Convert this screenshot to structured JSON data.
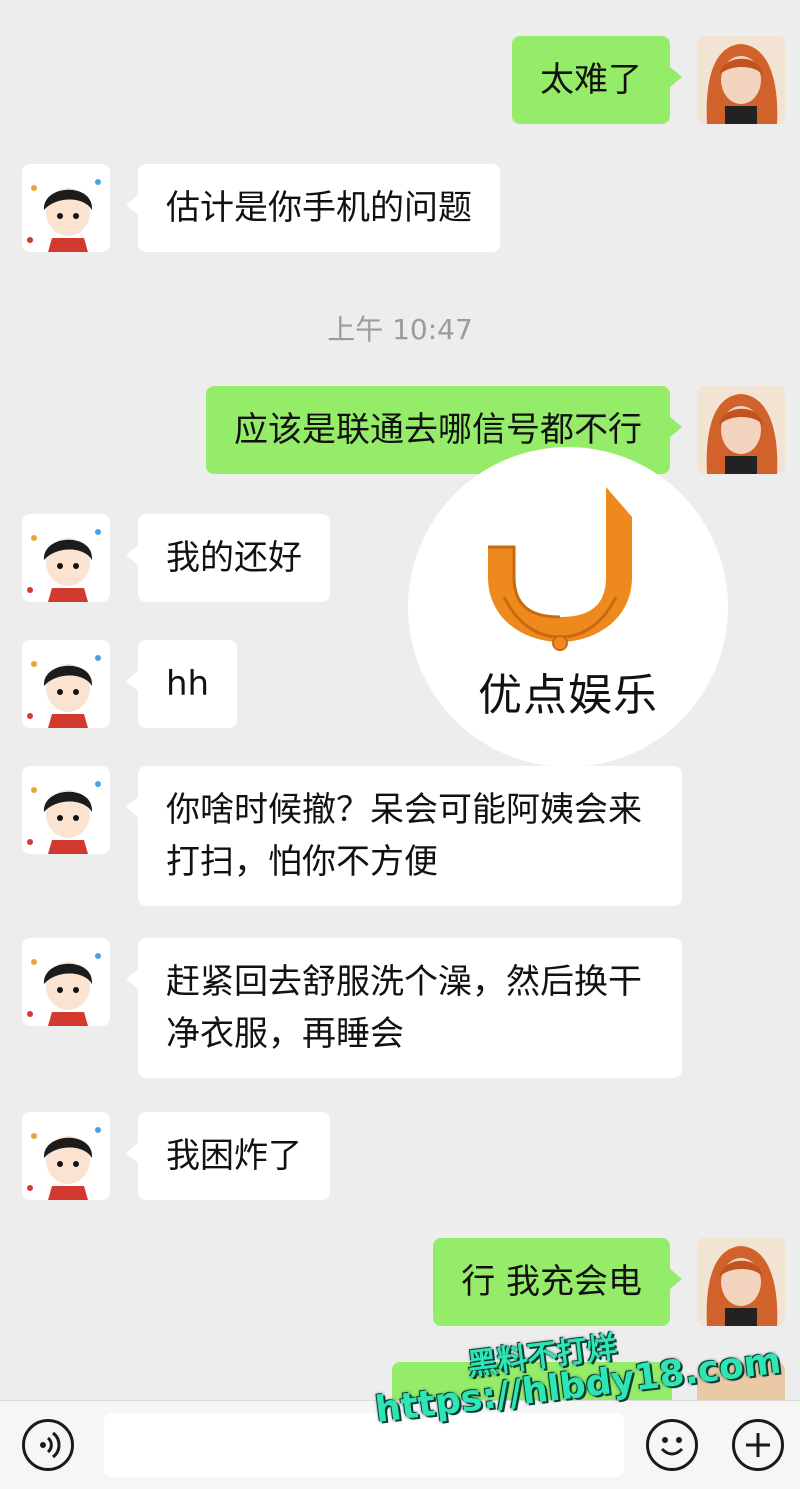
{
  "messages": [
    {
      "side": "out",
      "text": "太难了"
    },
    {
      "side": "in",
      "text": "估计是你手机的问题"
    },
    {
      "timestamp": "上午 10:47"
    },
    {
      "side": "out",
      "text": "应该是联通去哪信号都不行"
    },
    {
      "side": "in",
      "text": "我的还好"
    },
    {
      "side": "in",
      "text": "hh"
    },
    {
      "side": "in",
      "text": "你啥时候撤？呆会可能阿姨会来打扫，怕你不方便"
    },
    {
      "side": "in",
      "text": "赶紧回去舒服洗个澡，然后换干净衣服，再睡会"
    },
    {
      "side": "in",
      "text": "我困炸了"
    },
    {
      "side": "out",
      "text": "行 我充会电"
    }
  ],
  "watermark": {
    "brand": "优点娱乐"
  },
  "site_watermark": {
    "line1": "黑料不打烊",
    "line2": "https://hlbdy18.com"
  },
  "bottom_bar": {
    "voice_icon": "voice-icon",
    "emoji_icon": "emoji-icon",
    "plus_icon": "plus-icon"
  },
  "colors": {
    "background": "#ededed",
    "outgoing_bubble": "#95ec69",
    "incoming_bubble": "#ffffff",
    "brand_orange": "#ee8a1d"
  }
}
